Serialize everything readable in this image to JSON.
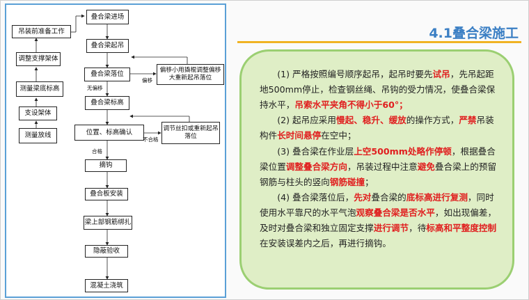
{
  "header": {
    "title": "4.1叠合梁施工"
  },
  "flowchart": {
    "right_column": [
      "叠合梁进场",
      "叠合梁起吊",
      "叠合梁落位",
      "叠合梁标高",
      "位置、标高确认",
      "摘钩",
      "叠合板安装",
      "梁上部钢筋绑扎",
      "隐蔽验收",
      "混凝土浇筑"
    ],
    "left_column": [
      "吊装前准备工作",
      "调整支撑架体",
      "测量梁底标高",
      "支设架体",
      "测量放线"
    ],
    "side_boxes": {
      "offset_adjust": "偏移小用撬棍调整偏移大重新起吊落位",
      "adjust_rehoist": "调节丝扣或重新起吊落位"
    },
    "labels": {
      "offset": "偏移",
      "no_offset": "无偏移",
      "fail": "不合格",
      "pass": "合格"
    }
  },
  "content": {
    "paragraphs": [
      [
        {
          "t": "(1) 严格按照编号顺序起吊，起吊时要先",
          "hl": false
        },
        {
          "t": "试吊",
          "hl": true
        },
        {
          "t": "，先吊起距地500mm停止，检查钢丝绳、吊钩的受力情况，使叠合梁保持水平，",
          "hl": false
        },
        {
          "t": "吊索水平夹角不得小于60°；",
          "hl": true
        }
      ],
      [
        {
          "t": "(2) 起吊应采用",
          "hl": false
        },
        {
          "t": "慢起、稳升、缓放",
          "hl": true
        },
        {
          "t": "的操作方式，",
          "hl": false
        },
        {
          "t": "严禁",
          "hl": true
        },
        {
          "t": "吊装构件",
          "hl": false
        },
        {
          "t": "长时间悬停",
          "hl": true
        },
        {
          "t": "在空中；",
          "hl": false
        }
      ],
      [
        {
          "t": "(3) 叠合梁在作业层",
          "hl": false
        },
        {
          "t": "上空500mm处略作停顿",
          "hl": true
        },
        {
          "t": "，根据叠合梁位置",
          "hl": false
        },
        {
          "t": "调整叠合梁方向",
          "hl": true
        },
        {
          "t": "，吊装过程中注意",
          "hl": false
        },
        {
          "t": "避免",
          "hl": true
        },
        {
          "t": "叠合梁上的预留钢筋与柱头的竖向",
          "hl": false
        },
        {
          "t": "钢筋碰撞",
          "hl": true
        },
        {
          "t": "；",
          "hl": false
        }
      ],
      [
        {
          "t": "(4) 叠合梁落位后，",
          "hl": false
        },
        {
          "t": "先对",
          "hl": true
        },
        {
          "t": "叠合梁的",
          "hl": false
        },
        {
          "t": "底标高进行复测",
          "hl": true
        },
        {
          "t": "，同时使用水平靠尺的水平气泡",
          "hl": false
        },
        {
          "t": "观察叠合梁是否水平",
          "hl": true
        },
        {
          "t": "，如出现偏差，及时对叠合梁和独立固定支撑",
          "hl": false
        },
        {
          "t": "进行调节",
          "hl": true
        },
        {
          "t": "，待",
          "hl": false
        },
        {
          "t": "标高和平整度控制",
          "hl": true
        },
        {
          "t": "在安装误差内之后，再进行摘钩。",
          "hl": false
        }
      ]
    ]
  },
  "colors": {
    "accent": "#3b7fc4",
    "highlight": "#e01f1f",
    "card_bg": "#dfeec6",
    "card_border": "#9bcf72",
    "divider": "#f0b323"
  }
}
